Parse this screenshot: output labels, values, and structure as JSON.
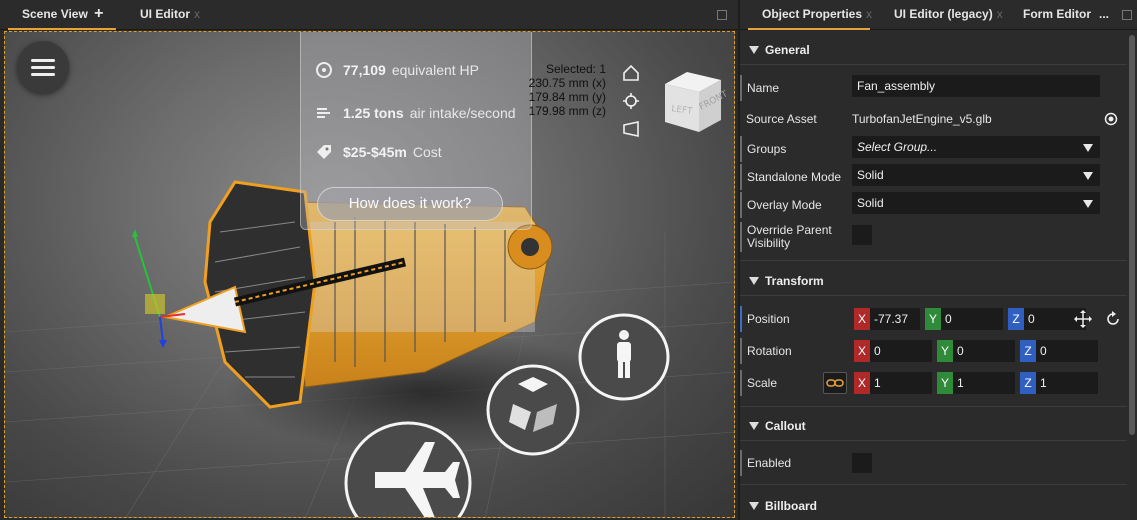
{
  "left_tabs": [
    {
      "label": "Scene View",
      "active": true
    },
    {
      "label": "UI Editor",
      "active": false
    }
  ],
  "scene": {
    "info_rows": [
      {
        "value": "77,109",
        "label": "equivalent HP"
      },
      {
        "value": "1.25 tons",
        "label": "air intake/second"
      },
      {
        "value": "$25-$45m",
        "label": "Cost"
      }
    ],
    "how_button": "How does it work?",
    "selection": {
      "selected": "Selected: 1",
      "x": "230.75 mm (x)",
      "y": "179.84 mm (y)",
      "z": "179.98 mm (z)"
    },
    "viewcube": {
      "left": "LEFT",
      "front": "FRONT"
    }
  },
  "right_tabs": [
    {
      "label": "Object Properties",
      "active": true
    },
    {
      "label": "UI Editor (legacy)",
      "active": false
    },
    {
      "label": "Form Editor",
      "active": false
    },
    {
      "label": "...",
      "active": false
    }
  ],
  "general": {
    "title": "General",
    "name_label": "Name",
    "name_value": "Fan_assembly",
    "source_label": "Source Asset",
    "source_value": "TurbofanJetEngine_v5.glb",
    "groups_label": "Groups",
    "groups_value": "Select Group...",
    "standalone_label": "Standalone Mode",
    "standalone_value": "Solid",
    "overlay_label": "Overlay Mode",
    "overlay_value": "Solid",
    "override_label_1": "Override Parent",
    "override_label_2": "Visibility"
  },
  "transform": {
    "title": "Transform",
    "position_label": "Position",
    "position": {
      "x": "-77.37",
      "y": "0",
      "z": "0"
    },
    "rotation_label": "Rotation",
    "rotation": {
      "x": "0",
      "y": "0",
      "z": "0"
    },
    "scale_label": "Scale",
    "scale": {
      "x": "1",
      "y": "1",
      "z": "1"
    }
  },
  "axis_letters": {
    "x": "X",
    "y": "Y",
    "z": "Z"
  },
  "callout": {
    "title": "Callout",
    "enabled_label": "Enabled"
  },
  "billboard": {
    "title": "Billboard"
  },
  "colors": {
    "accent": "#e6a33c",
    "axis_x": "#b02828",
    "axis_y": "#2f8a3a",
    "axis_z": "#2f5fc0"
  }
}
